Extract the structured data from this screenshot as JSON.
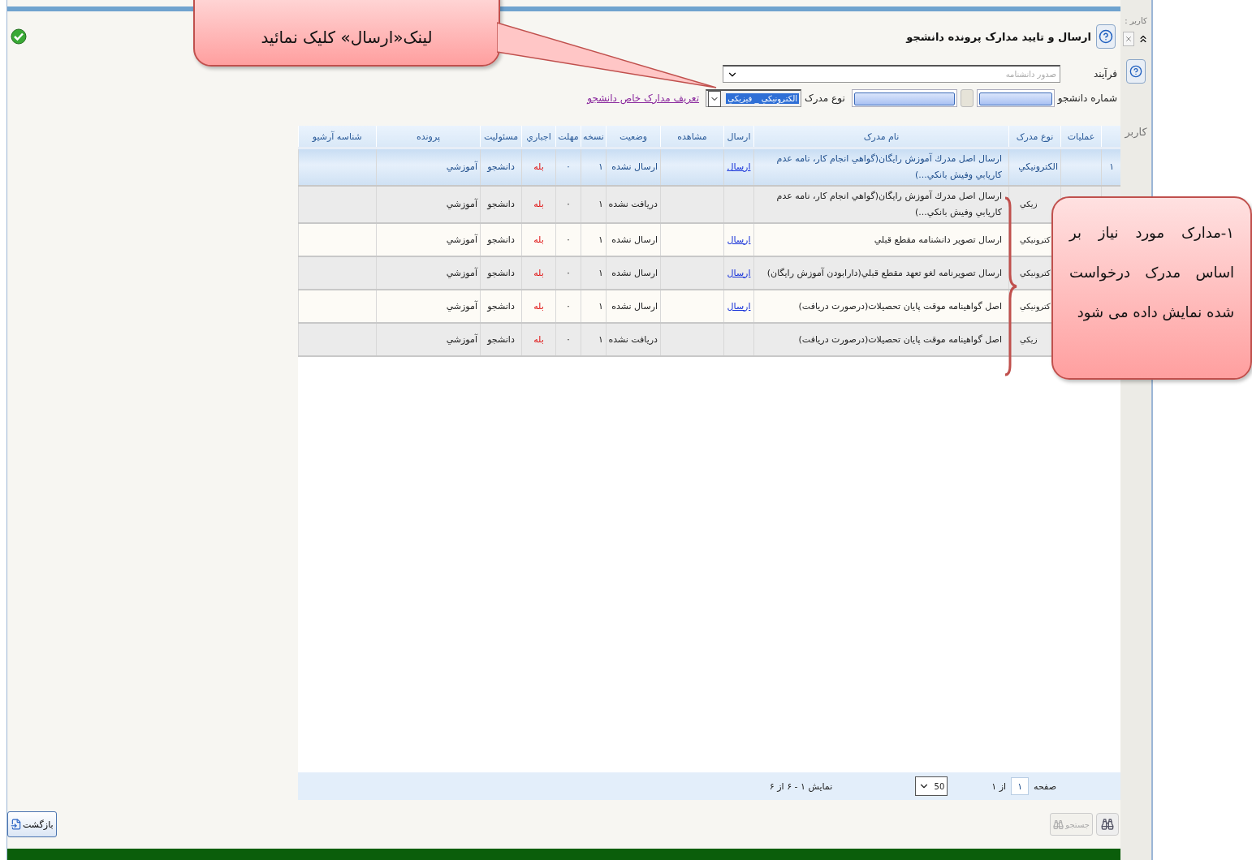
{
  "window": {
    "title": "ارسال و تایید مدارک پرونده دانشجو"
  },
  "side_panel": {
    "user_label": "کاربر :",
    "user_label_bottom": "کاربر"
  },
  "form": {
    "process_label": "فرآیند",
    "process_value": "صدور دانشنامه",
    "student_number_label": "شماره دانشجو",
    "doc_type_label": "نوع مدرک",
    "doc_type_value": "الکترونیکي _ فیزیکي",
    "special_docs_link": "تعریف مدارک خاص دانشجو"
  },
  "table": {
    "columns": [
      "عملیات",
      "نوع مدرک",
      "نام مدرک",
      "ارسال",
      "مشاهده",
      "وضعیت",
      "نسخه",
      "مهلت",
      "اجباري",
      "مسئولیت",
      "پرونده",
      "شناسه آرشیو"
    ],
    "rows": [
      {
        "selected": true,
        "number": "۱",
        "doc_type": "الکترونیکي",
        "name": "ارسال اصل مدرك آموزش رایگان(گواهي انجام كار، نامه عدم كاريابي وفيش بانكي...)",
        "send_link": "ارسال",
        "status": "ارسال نشده",
        "copies": "۱",
        "deadline": "۰",
        "mandatory": "بله",
        "responsible": "دانشجو",
        "file": "آموزشي"
      },
      {
        "selected": false,
        "doc_type": "زيكي",
        "name": "ارسال اصل مدرك آموزش رایگان(گواهي انجام كار، نامه عدم كاريابي وفيش بانكي...)",
        "status": "دریافت نشده",
        "copies": "۱",
        "deadline": "۰",
        "mandatory": "بله",
        "responsible": "دانشجو",
        "file": "آموزشي"
      },
      {
        "selected": false,
        "doc_type": "كترونيكي",
        "name": "ارسال تصویر دانشنامه مقطع قبلي",
        "send_link": "ارسال",
        "status": "ارسال نشده",
        "copies": "۱",
        "deadline": "۰",
        "mandatory": "بله",
        "responsible": "دانشجو",
        "file": "آموزشي"
      },
      {
        "selected": false,
        "doc_type": "كترونيكي",
        "name": "ارسال تصويرنامه لغو تعهد مقطع قبلي(دارابودن آموزش رایگان)",
        "send_link": "ارسال",
        "status": "ارسال نشده",
        "copies": "۱",
        "deadline": "۰",
        "mandatory": "بله",
        "responsible": "دانشجو",
        "file": "آموزشي"
      },
      {
        "selected": false,
        "doc_type": "كترونيكي",
        "name": "اصل گواهينامه موقت پایان تحصیلات(درصورت دریافت)",
        "send_link": "ارسال",
        "status": "ارسال نشده",
        "copies": "۱",
        "deadline": "۰",
        "mandatory": "بله",
        "responsible": "دانشجو",
        "file": "آموزشي"
      },
      {
        "selected": false,
        "doc_type": "زيكي",
        "name": "اصل گواهينامه موقت پایان تحصیلات(درصورت دریافت)",
        "status": "دریافت نشده",
        "copies": "۱",
        "deadline": "۰",
        "mandatory": "بله",
        "responsible": "دانشجو",
        "file": "آموزشي"
      }
    ]
  },
  "pager": {
    "page_label": "صفحه",
    "page": "۱",
    "of": "از ۱",
    "page_size": "50",
    "summary": "نمایش ۱ - ۶ از ۶"
  },
  "buttons": {
    "back": "بازگشت",
    "search": "جستجو",
    "search_disabled": true
  },
  "callouts": [
    {
      "text": "لینک«ارسال» کلیک نمائید"
    },
    {
      "text": "۱-مدارک مورد نیاز بر اساس مدرک درخواست شده نمایش داده می شود"
    }
  ]
}
